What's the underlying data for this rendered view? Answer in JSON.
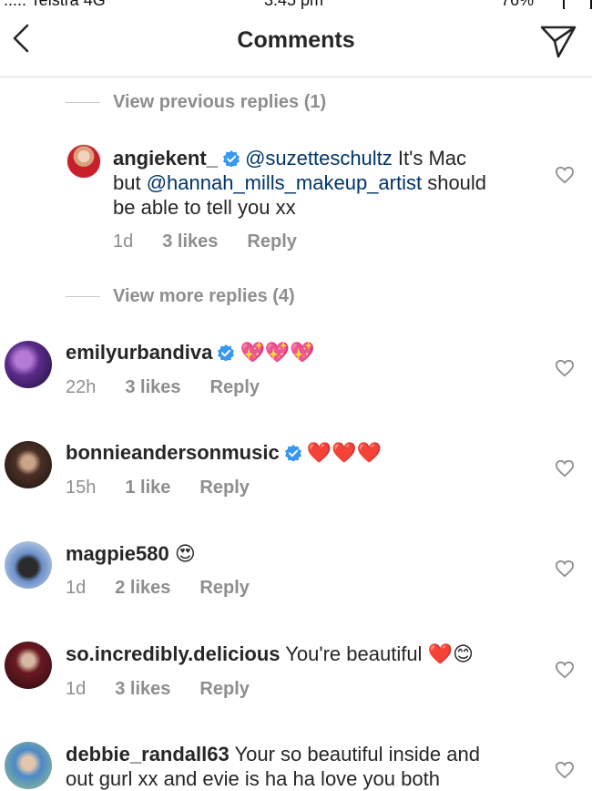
{
  "status": {
    "carrier": "..... Telstra 4G",
    "time": "3:45 pm",
    "battery": "76%"
  },
  "header": {
    "title": "Comments"
  },
  "view_previous": "View previous replies (1)",
  "view_more": "View more replies (4)",
  "comments": [
    {
      "username": "angiekent_",
      "verified": true,
      "mention1": "@suzetteschultz",
      "text1": " It's Mac",
      "line2_pre": "but ",
      "mention2": "@hannah_mills_makeup_artist",
      "line2_post": " should",
      "line3": "be able to tell you xx",
      "time": "1d",
      "likes": "3 likes",
      "reply": "Reply"
    },
    {
      "username": "emilyurbandiva",
      "verified": true,
      "text": "💖💖💖",
      "time": "22h",
      "likes": "3 likes",
      "reply": "Reply"
    },
    {
      "username": "bonnieandersonmusic",
      "verified": true,
      "text": "❤️❤️❤️",
      "time": "15h",
      "likes": "1 like",
      "reply": "Reply"
    },
    {
      "username": "magpie580",
      "verified": false,
      "text": "😍",
      "time": "1d",
      "likes": "2 likes",
      "reply": "Reply"
    },
    {
      "username": "so.incredibly.delicious",
      "verified": false,
      "text": " You're beautiful ❤️😊",
      "time": "1d",
      "likes": "3 likes",
      "reply": "Reply"
    },
    {
      "username": "debbie_randall63",
      "verified": false,
      "text": " Your so beautiful inside and",
      "line2": "out gurl xx and evie is ha ha love you both"
    }
  ],
  "colors": {
    "verified": "#3897f0",
    "mention": "#003569",
    "meta": "#8e8e8e",
    "divider": "#dbdbdb"
  }
}
